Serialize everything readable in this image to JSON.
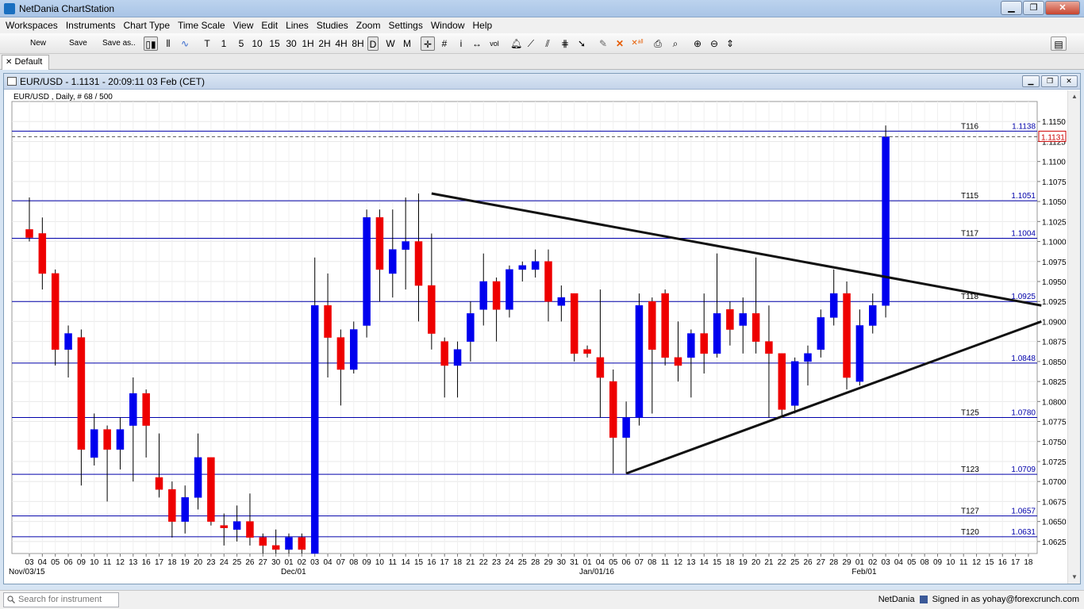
{
  "app": {
    "title": "NetDania ChartStation"
  },
  "menu": [
    "Workspaces",
    "Instruments",
    "Chart Type",
    "Time Scale",
    "View",
    "Edit",
    "Lines",
    "Studies",
    "Zoom",
    "Settings",
    "Window",
    "Help"
  ],
  "toolbar": {
    "new_label": "New",
    "save_label": "Save",
    "save_as_label": "Save as..",
    "timeframes": [
      "T",
      "1",
      "5",
      "10",
      "15",
      "30",
      "1H",
      "2H",
      "4H",
      "8H",
      "D",
      "W",
      "M"
    ],
    "active_timeframe": "D"
  },
  "tabs": [
    {
      "label": "Default"
    }
  ],
  "chart_window": {
    "title": "EUR/USD - 1.1131 - 20:09:11  03 Feb (CET)",
    "subtitle": "EUR/USD , Daily, # 68 / 500"
  },
  "statusbar": {
    "search_placeholder": "Search for instrument",
    "brand": "NetDania",
    "signed_in": "Signed in as yohay@forexcrunch.com"
  },
  "chart_data": {
    "type": "candlestick",
    "symbol": "EUR/USD",
    "timeframe": "Daily",
    "ylim": [
      1.061,
      1.1175
    ],
    "yticks": [
      1.0625,
      1.065,
      1.0675,
      1.07,
      1.0725,
      1.075,
      1.0775,
      1.08,
      1.0825,
      1.085,
      1.0875,
      1.09,
      1.0925,
      1.095,
      1.0975,
      1.1,
      1.1025,
      1.105,
      1.1075,
      1.11,
      1.1125,
      1.115
    ],
    "ytick_labels": [
      "1.0625",
      "1.0650",
      "1.0675",
      "1.0700",
      "1.0725",
      "1.0750",
      "1.0775",
      "1.0800",
      "1.0825",
      "1.0850",
      "1.0875",
      "1.0900",
      "1.0925",
      "1.0950",
      "1.0975",
      "1.1000",
      "1.1025",
      "1.1050",
      "1.1075",
      "1.1100",
      "1.1125",
      "1.1150"
    ],
    "x_day_labels": [
      "03",
      "04",
      "05",
      "06",
      "09",
      "10",
      "11",
      "12",
      "13",
      "16",
      "17",
      "18",
      "19",
      "20",
      "23",
      "24",
      "25",
      "26",
      "27",
      "30",
      "01",
      "02",
      "03",
      "04",
      "07",
      "08",
      "09",
      "10",
      "11",
      "14",
      "15",
      "16",
      "17",
      "18",
      "21",
      "22",
      "23",
      "24",
      "25",
      "28",
      "29",
      "30",
      "31",
      "01",
      "04",
      "05",
      "06",
      "07",
      "08",
      "11",
      "12",
      "13",
      "14",
      "15",
      "18",
      "19",
      "20",
      "21",
      "22",
      "25",
      "26",
      "27",
      "28",
      "29",
      "01",
      "02",
      "03",
      "04",
      "05",
      "08",
      "09",
      "10",
      "11",
      "12",
      "15",
      "16",
      "17",
      "18"
    ],
    "x_month_labels": [
      {
        "label": "Nov/03/15",
        "index": 0
      },
      {
        "label": "Dec/01",
        "index": 20
      },
      {
        "label": "Jan/01/16",
        "index": 43
      },
      {
        "label": "Feb/01",
        "index": 64
      }
    ],
    "candles": [
      {
        "date": "Nov 03",
        "open": 1.1015,
        "high": 1.1055,
        "low": 1.1,
        "close": 1.1005
      },
      {
        "date": "Nov 04",
        "open": 1.101,
        "high": 1.103,
        "low": 1.094,
        "close": 1.096
      },
      {
        "date": "Nov 05",
        "open": 1.096,
        "high": 1.0965,
        "low": 1.0845,
        "close": 1.0865
      },
      {
        "date": "Nov 06",
        "open": 1.0865,
        "high": 1.0895,
        "low": 1.083,
        "close": 1.0885
      },
      {
        "date": "Nov 09",
        "open": 1.088,
        "high": 1.089,
        "low": 1.0695,
        "close": 1.074
      },
      {
        "date": "Nov 10",
        "open": 1.073,
        "high": 1.0785,
        "low": 1.072,
        "close": 1.0765
      },
      {
        "date": "Nov 11",
        "open": 1.0765,
        "high": 1.077,
        "low": 1.0675,
        "close": 1.074
      },
      {
        "date": "Nov 12",
        "open": 1.074,
        "high": 1.078,
        "low": 1.0715,
        "close": 1.0765
      },
      {
        "date": "Nov 13",
        "open": 1.077,
        "high": 1.083,
        "low": 1.07,
        "close": 1.081
      },
      {
        "date": "Nov 16",
        "open": 1.081,
        "high": 1.0815,
        "low": 1.073,
        "close": 1.077
      },
      {
        "date": "Nov 17",
        "open": 1.0705,
        "high": 1.076,
        "low": 1.068,
        "close": 1.069
      },
      {
        "date": "Nov 18",
        "open": 1.069,
        "high": 1.07,
        "low": 1.063,
        "close": 1.065
      },
      {
        "date": "Nov 19",
        "open": 1.065,
        "high": 1.0695,
        "low": 1.0635,
        "close": 1.068
      },
      {
        "date": "Nov 20",
        "open": 1.068,
        "high": 1.076,
        "low": 1.0665,
        "close": 1.073
      },
      {
        "date": "Nov 23",
        "open": 1.073,
        "high": 1.073,
        "low": 1.0645,
        "close": 1.065
      },
      {
        "date": "Nov 24",
        "open": 1.0645,
        "high": 1.066,
        "low": 1.062,
        "close": 1.0642
      },
      {
        "date": "Nov 25",
        "open": 1.064,
        "high": 1.067,
        "low": 1.0625,
        "close": 1.065
      },
      {
        "date": "Nov 26",
        "open": 1.065,
        "high": 1.0685,
        "low": 1.062,
        "close": 1.063
      },
      {
        "date": "Nov 27",
        "open": 1.063,
        "high": 1.0635,
        "low": 1.061,
        "close": 1.062
      },
      {
        "date": "Nov 30",
        "open": 1.062,
        "high": 1.064,
        "low": 1.061,
        "close": 1.0615
      },
      {
        "date": "Dec 01",
        "open": 1.0615,
        "high": 1.0635,
        "low": 1.061,
        "close": 1.063
      },
      {
        "date": "Dec 02",
        "open": 1.063,
        "high": 1.0635,
        "low": 1.061,
        "close": 1.0615
      },
      {
        "date": "Dec 03",
        "open": 1.061,
        "high": 1.098,
        "low": 1.061,
        "close": 1.092
      },
      {
        "date": "Dec 04",
        "open": 1.092,
        "high": 1.096,
        "low": 1.083,
        "close": 1.088
      },
      {
        "date": "Dec 07",
        "open": 1.088,
        "high": 1.089,
        "low": 1.0795,
        "close": 1.084
      },
      {
        "date": "Dec 08",
        "open": 1.084,
        "high": 1.09,
        "low": 1.0835,
        "close": 1.089
      },
      {
        "date": "Dec 09",
        "open": 1.0895,
        "high": 1.104,
        "low": 1.088,
        "close": 1.103
      },
      {
        "date": "Dec 10",
        "open": 1.103,
        "high": 1.104,
        "low": 1.0925,
        "close": 1.0965
      },
      {
        "date": "Dec 11",
        "open": 1.096,
        "high": 1.104,
        "low": 1.093,
        "close": 1.099
      },
      {
        "date": "Dec 14",
        "open": 1.099,
        "high": 1.1055,
        "low": 1.094,
        "close": 1.1
      },
      {
        "date": "Dec 15",
        "open": 1.1,
        "high": 1.106,
        "low": 1.09,
        "close": 1.0945
      },
      {
        "date": "Dec 16",
        "open": 1.0945,
        "high": 1.101,
        "low": 1.0865,
        "close": 1.0885
      },
      {
        "date": "Dec 17",
        "open": 1.0875,
        "high": 1.088,
        "low": 1.0805,
        "close": 1.0845
      },
      {
        "date": "Dec 18",
        "open": 1.0845,
        "high": 1.0875,
        "low": 1.0805,
        "close": 1.0865
      },
      {
        "date": "Dec 21",
        "open": 1.0875,
        "high": 1.0925,
        "low": 1.085,
        "close": 1.091
      },
      {
        "date": "Dec 22",
        "open": 1.0915,
        "high": 1.0985,
        "low": 1.0895,
        "close": 1.095
      },
      {
        "date": "Dec 23",
        "open": 1.095,
        "high": 1.0955,
        "low": 1.0875,
        "close": 1.0915
      },
      {
        "date": "Dec 24",
        "open": 1.0915,
        "high": 1.097,
        "low": 1.0905,
        "close": 1.0965
      },
      {
        "date": "Dec 25",
        "open": 1.0965,
        "high": 1.0975,
        "low": 1.095,
        "close": 1.097
      },
      {
        "date": "Dec 28",
        "open": 1.0965,
        "high": 1.099,
        "low": 1.0955,
        "close": 1.0975
      },
      {
        "date": "Dec 29",
        "open": 1.0975,
        "high": 1.099,
        "low": 1.09,
        "close": 1.0925
      },
      {
        "date": "Dec 30",
        "open": 1.092,
        "high": 1.0945,
        "low": 1.09,
        "close": 1.093
      },
      {
        "date": "Dec 31",
        "open": 1.0935,
        "high": 1.0935,
        "low": 1.085,
        "close": 1.086
      },
      {
        "date": "Jan 01",
        "open": 1.0865,
        "high": 1.087,
        "low": 1.0855,
        "close": 1.086
      },
      {
        "date": "Jan 04",
        "open": 1.0855,
        "high": 1.094,
        "low": 1.078,
        "close": 1.083
      },
      {
        "date": "Jan 05",
        "open": 1.0825,
        "high": 1.084,
        "low": 1.071,
        "close": 1.0755
      },
      {
        "date": "Jan 06",
        "open": 1.0755,
        "high": 1.08,
        "low": 1.071,
        "close": 1.078
      },
      {
        "date": "Jan 07",
        "open": 1.078,
        "high": 1.0935,
        "low": 1.077,
        "close": 1.092
      },
      {
        "date": "Jan 08",
        "open": 1.0925,
        "high": 1.093,
        "low": 1.0785,
        "close": 1.0865
      },
      {
        "date": "Jan 11",
        "open": 1.0935,
        "high": 1.094,
        "low": 1.0845,
        "close": 1.0855
      },
      {
        "date": "Jan 12",
        "open": 1.0855,
        "high": 1.09,
        "low": 1.0825,
        "close": 1.0845
      },
      {
        "date": "Jan 13",
        "open": 1.0855,
        "high": 1.089,
        "low": 1.0805,
        "close": 1.0885
      },
      {
        "date": "Jan 14",
        "open": 1.0885,
        "high": 1.0935,
        "low": 1.0835,
        "close": 1.086
      },
      {
        "date": "Jan 15",
        "open": 1.086,
        "high": 1.0985,
        "low": 1.0855,
        "close": 1.091
      },
      {
        "date": "Jan 18",
        "open": 1.0915,
        "high": 1.0925,
        "low": 1.087,
        "close": 1.089
      },
      {
        "date": "Jan 19",
        "open": 1.0895,
        "high": 1.093,
        "low": 1.086,
        "close": 1.091
      },
      {
        "date": "Jan 20",
        "open": 1.091,
        "high": 1.098,
        "low": 1.086,
        "close": 1.0875
      },
      {
        "date": "Jan 21",
        "open": 1.0875,
        "high": 1.092,
        "low": 1.078,
        "close": 1.086
      },
      {
        "date": "Jan 22",
        "open": 1.086,
        "high": 1.086,
        "low": 1.078,
        "close": 1.079
      },
      {
        "date": "Jan 25",
        "open": 1.0795,
        "high": 1.0855,
        "low": 1.0785,
        "close": 1.085
      },
      {
        "date": "Jan 26",
        "open": 1.085,
        "high": 1.087,
        "low": 1.082,
        "close": 1.086
      },
      {
        "date": "Jan 27",
        "open": 1.0865,
        "high": 1.0915,
        "low": 1.0855,
        "close": 1.0905
      },
      {
        "date": "Jan 28",
        "open": 1.0905,
        "high": 1.0965,
        "low": 1.0895,
        "close": 1.0935
      },
      {
        "date": "Jan 29",
        "open": 1.0935,
        "high": 1.095,
        "low": 1.0815,
        "close": 1.083
      },
      {
        "date": "Feb 01",
        "open": 1.0825,
        "high": 1.0915,
        "low": 1.082,
        "close": 1.0895
      },
      {
        "date": "Feb 02",
        "open": 1.0895,
        "high": 1.0935,
        "low": 1.0885,
        "close": 1.092
      },
      {
        "date": "Feb 03",
        "open": 1.092,
        "high": 1.1145,
        "low": 1.0905,
        "close": 1.1131
      }
    ],
    "bull_color": "#0000ee",
    "bear_color": "#ee0000",
    "horizontal_lines": [
      {
        "name": "T116",
        "value": 1.1138,
        "label": "1.1138"
      },
      {
        "name": "T115",
        "value": 1.1051,
        "label": "1.1051"
      },
      {
        "name": "T117",
        "value": 1.1004,
        "label": "1.1004"
      },
      {
        "name": "T118",
        "value": 1.0925,
        "label": "1.0925"
      },
      {
        "name": "",
        "value": 1.0848,
        "label": "1.0848"
      },
      {
        "name": "T125",
        "value": 1.078,
        "label": "1.0780"
      },
      {
        "name": "T123",
        "value": 1.0709,
        "label": "1.0709"
      },
      {
        "name": "T127",
        "value": 1.0657,
        "label": "1.0657"
      },
      {
        "name": "T120",
        "value": 1.0631,
        "label": "1.0631"
      }
    ],
    "line_color": "#0000aa",
    "trendlines": [
      {
        "from": {
          "index": 31,
          "value": 1.106
        },
        "to": {
          "index": 78,
          "value": 1.092
        }
      },
      {
        "from": {
          "index": 46,
          "value": 1.071
        },
        "to": {
          "index": 78,
          "value": 1.09
        }
      }
    ],
    "last_price": {
      "value": 1.1131,
      "label": "1.1131",
      "color": "#cc0000"
    },
    "grid": true
  }
}
